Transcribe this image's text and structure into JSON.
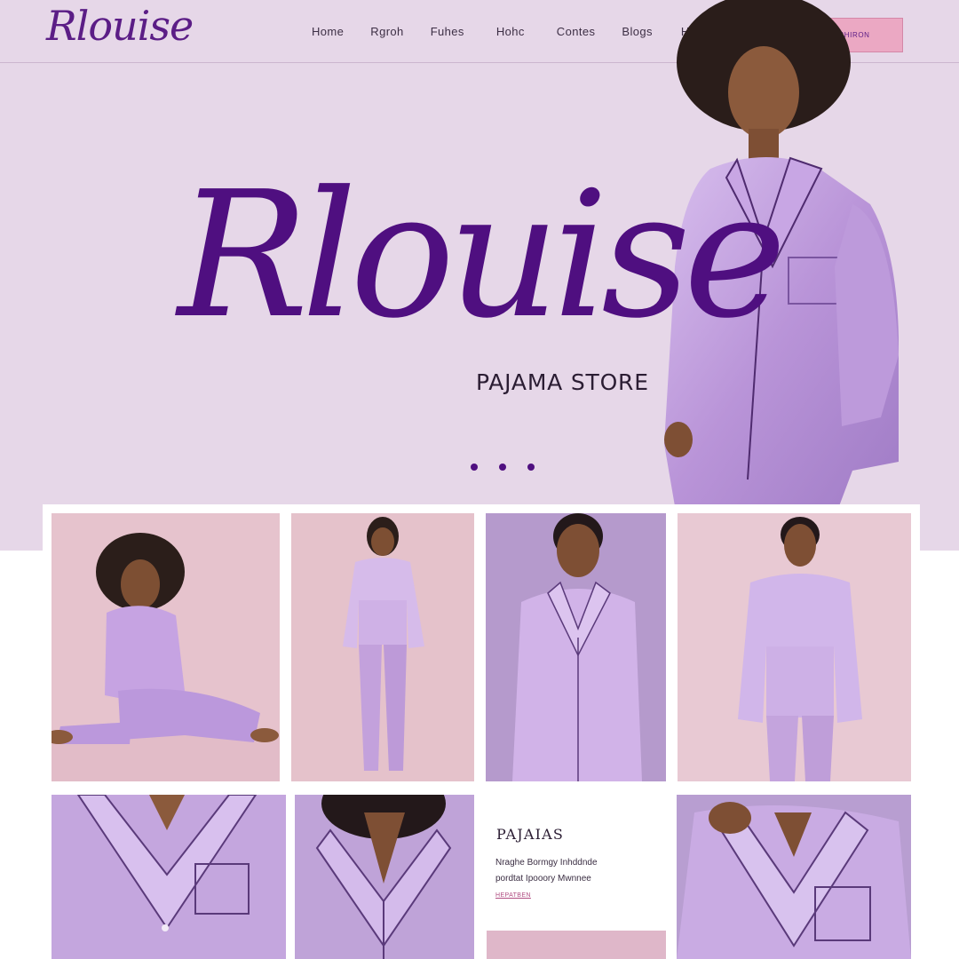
{
  "header": {
    "logo": "Rlouise",
    "nav": [
      "Home",
      "Rgroh",
      "Fuhes",
      "Hohc",
      "Contes",
      "Blogs",
      "Ha"
    ],
    "cta_label": "WMAET MSA CHIRON"
  },
  "hero": {
    "brand": "Rlouise",
    "tagline": "PAJAMA STORE",
    "slide_count": 3,
    "active_slide": 0
  },
  "info_card": {
    "title": "PAJAIAS",
    "line1": "Nraghe Bormgy Inhddnde",
    "line2": "pordtat Ipooory Mwnnee",
    "link": "HEPATBEN"
  },
  "colors": {
    "hero_bg": "#e6d7e8",
    "brand_purple": "#4f0f80",
    "cta_pink": "#eba8c3",
    "satin_lavender": "#c3a2dc"
  },
  "icons": {
    "carousel_dot": "dot-icon"
  }
}
